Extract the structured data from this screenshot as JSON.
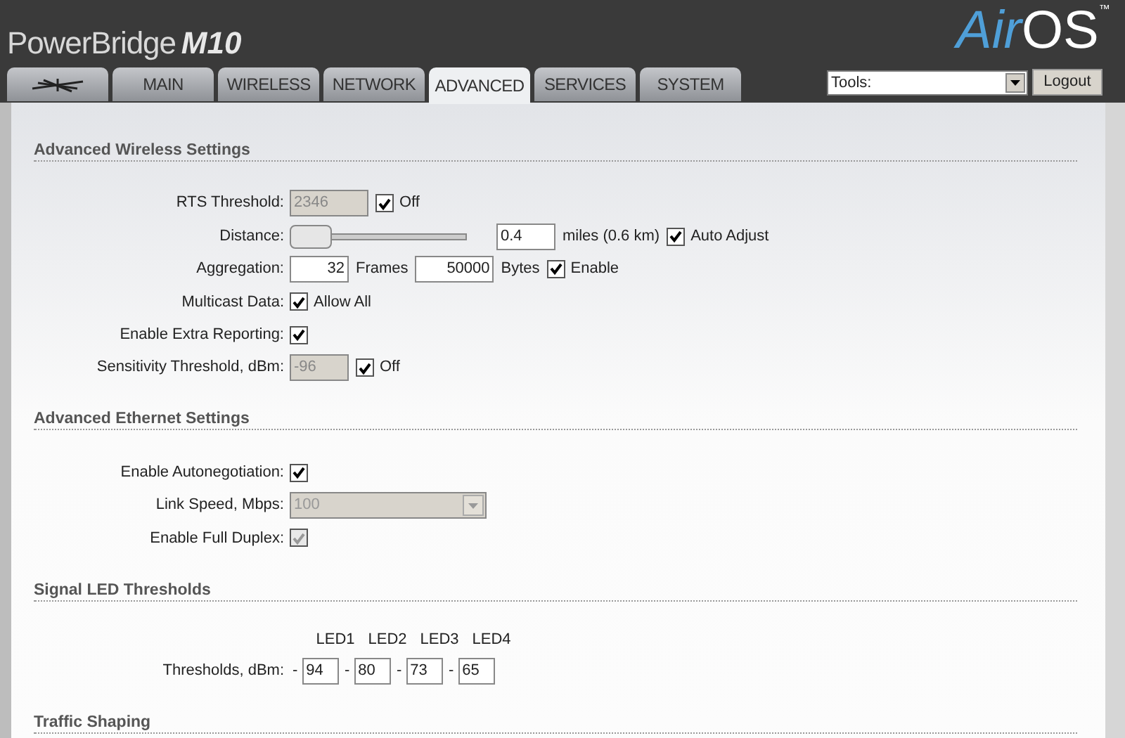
{
  "header": {
    "product": "PowerBridge",
    "model": "M10",
    "brand_air": "Air",
    "brand_os": "OS",
    "trademark": "™"
  },
  "tabs": [
    {
      "kind": "logo",
      "selected": false
    },
    {
      "label": "MAIN",
      "selected": false
    },
    {
      "label": "WIRELESS",
      "selected": false
    },
    {
      "label": "NETWORK",
      "selected": false
    },
    {
      "label": "ADVANCED",
      "selected": true
    },
    {
      "label": "SERVICES",
      "selected": false
    },
    {
      "label": "SYSTEM",
      "selected": false
    }
  ],
  "tools_select": {
    "value": "Tools:"
  },
  "logout_button": "Logout",
  "sections": [
    {
      "title": "Advanced Wireless Settings",
      "rows": [
        {
          "label": "RTS Threshold:",
          "controls": [
            {
              "kind": "input",
              "value": "2346",
              "disabled": true
            },
            {
              "kind": "checkbox",
              "checked": true,
              "disabled": false,
              "label": "Off"
            }
          ]
        },
        {
          "label": "Distance:",
          "controls": [
            {
              "kind": "slider",
              "level": 0
            },
            {
              "kind": "input",
              "value": "0.4",
              "disabled": false
            },
            {
              "kind": "text",
              "text": "miles (0.6 km)"
            },
            {
              "kind": "checkbox",
              "checked": true,
              "disabled": false,
              "label": "Auto Adjust"
            }
          ]
        },
        {
          "label": "Aggregation:",
          "controls": [
            {
              "kind": "number",
              "value": "32",
              "disabled": false
            },
            {
              "kind": "text",
              "text": "Frames"
            },
            {
              "kind": "number",
              "value": "50000",
              "disabled": false
            },
            {
              "kind": "text",
              "text": "Bytes"
            },
            {
              "kind": "checkbox",
              "checked": true,
              "disabled": false,
              "label": "Enable"
            }
          ]
        },
        {
          "label": "Multicast Data:",
          "controls": [
            {
              "kind": "checkbox",
              "checked": true,
              "disabled": false,
              "label": "Allow All"
            }
          ]
        },
        {
          "label": "Enable Extra Reporting:",
          "controls": [
            {
              "kind": "checkbox",
              "checked": true,
              "disabled": false
            }
          ]
        },
        {
          "label": "Sensitivity Threshold, dBm:",
          "controls": [
            {
              "kind": "input",
              "value": "-96",
              "disabled": true
            },
            {
              "kind": "checkbox",
              "checked": true,
              "disabled": false,
              "label": "Off"
            }
          ]
        }
      ]
    },
    {
      "title": "Advanced Ethernet Settings",
      "rows": [
        {
          "label": "Enable Autonegotiation:",
          "controls": [
            {
              "kind": "checkbox",
              "checked": true,
              "disabled": false
            }
          ]
        },
        {
          "label": "Link Speed, Mbps:",
          "controls": [
            {
              "kind": "select",
              "value": "100",
              "disabled": true
            }
          ]
        },
        {
          "label": "Enable Full Duplex:",
          "controls": [
            {
              "kind": "checkbox",
              "checked": true,
              "disabled": true
            }
          ]
        }
      ]
    },
    {
      "title": "Signal LED Thresholds",
      "rows": [
        {
          "label": "Thresholds, dBm:",
          "controls": [
            {
              "kind": "leds",
              "separator": "-",
              "leds": [
                {
                  "name": "LED1",
                  "value": "94"
                },
                {
                  "name": "LED2",
                  "value": "80"
                },
                {
                  "name": "LED3",
                  "value": "73"
                },
                {
                  "name": "LED4",
                  "value": "65"
                }
              ]
            }
          ]
        }
      ]
    },
    {
      "title": "Traffic Shaping"
    }
  ]
}
